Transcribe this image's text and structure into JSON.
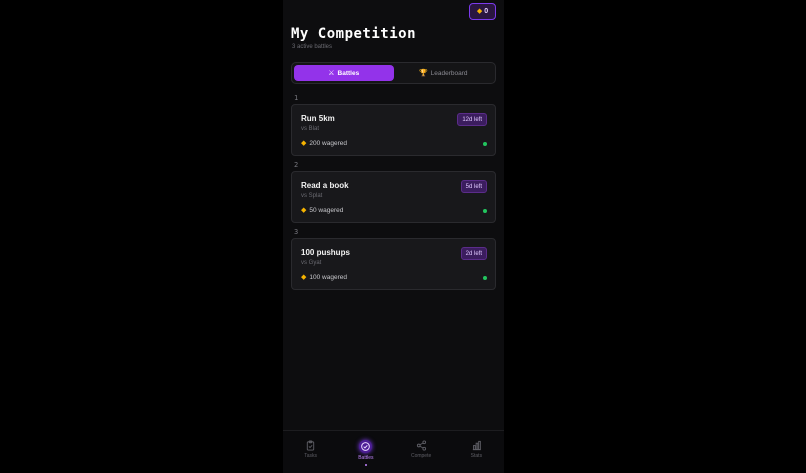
{
  "header": {
    "coins": "0",
    "title": "My Competition",
    "subtitle": "3 active battles"
  },
  "tabs": [
    {
      "label": "Battles",
      "icon": "crossed-swords-icon",
      "active": true
    },
    {
      "label": "Leaderboard",
      "icon": "trophy-icon",
      "active": false
    }
  ],
  "battles": [
    {
      "rank": "1",
      "title": "Run 5km",
      "opponent": "vs Blat",
      "wager": "200 wagered",
      "time_left": "12d left"
    },
    {
      "rank": "2",
      "title": "Read a book",
      "opponent": "vs Splat",
      "wager": "50 wagered",
      "time_left": "5d left"
    },
    {
      "rank": "3",
      "title": "100 pushups",
      "opponent": "vs Gyat",
      "wager": "100 wagered",
      "time_left": "2d left"
    }
  ],
  "nav": [
    {
      "label": "Tasks",
      "icon": "clipboard-check-icon",
      "active": false
    },
    {
      "label": "Battles",
      "icon": "check-circle-icon",
      "active": true
    },
    {
      "label": "Compete",
      "icon": "share-icon",
      "active": false
    },
    {
      "label": "Stats",
      "icon": "bar-chart-icon",
      "active": false
    }
  ],
  "colors": {
    "accent": "#9333ea",
    "coin": "#f5b300",
    "status_active": "#22c55e"
  }
}
